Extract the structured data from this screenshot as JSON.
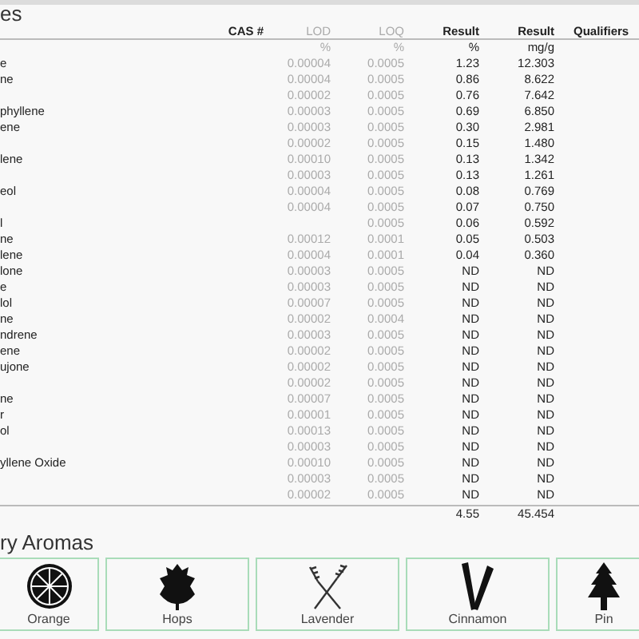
{
  "section_title": "es",
  "table": {
    "columns": [
      "CAS #",
      "LOD",
      "LOQ",
      "Result",
      "Result",
      "Qualifiers"
    ],
    "units": [
      "%",
      "%",
      "%",
      "mg/g"
    ],
    "rows": [
      {
        "name": "e",
        "lod": "0.00004",
        "loq": "0.0005",
        "result_pct": "1.23",
        "result_mg": "12.303"
      },
      {
        "name": "ne",
        "lod": "0.00004",
        "loq": "0.0005",
        "result_pct": "0.86",
        "result_mg": "8.622"
      },
      {
        "lod": "0.00002",
        "loq": "0.0005",
        "result_pct": "0.76",
        "result_mg": "7.642"
      },
      {
        "name": "phyllene",
        "lod": "0.00003",
        "loq": "0.0005",
        "result_pct": "0.69",
        "result_mg": "6.850"
      },
      {
        "name": "ene",
        "lod": "0.00003",
        "loq": "0.0005",
        "result_pct": "0.30",
        "result_mg": "2.981"
      },
      {
        "lod": "0.00002",
        "loq": "0.0005",
        "result_pct": "0.15",
        "result_mg": "1.480"
      },
      {
        "name": "lene",
        "lod": "0.00010",
        "loq": "0.0005",
        "result_pct": "0.13",
        "result_mg": "1.342"
      },
      {
        "lod": "0.00003",
        "loq": "0.0005",
        "result_pct": "0.13",
        "result_mg": "1.261"
      },
      {
        "name": "eol",
        "lod": "0.00004",
        "loq": "0.0005",
        "result_pct": "0.08",
        "result_mg": "0.769"
      },
      {
        "lod": "0.00004",
        "loq": "0.0005",
        "result_pct": "0.07",
        "result_mg": "0.750"
      },
      {
        "name": "l",
        "loq": "0.0005",
        "result_pct": "0.06",
        "result_mg": "0.592"
      },
      {
        "name": "ne",
        "lod": "0.00012",
        "loq": "0.0001",
        "result_pct": "0.05",
        "result_mg": "0.503"
      },
      {
        "name": "lene",
        "lod": "0.00004",
        "loq": "0.0001",
        "result_pct": "0.04",
        "result_mg": "0.360"
      },
      {
        "name": "lone",
        "lod": "0.00003",
        "loq": "0.0005",
        "result_pct": "ND",
        "result_mg": "ND"
      },
      {
        "name": "e",
        "lod": "0.00003",
        "loq": "0.0005",
        "result_pct": "ND",
        "result_mg": "ND"
      },
      {
        "name": "lol",
        "lod": "0.00007",
        "loq": "0.0005",
        "result_pct": "ND",
        "result_mg": "ND"
      },
      {
        "name": "ne",
        "lod": "0.00002",
        "loq": "0.0004",
        "result_pct": "ND",
        "result_mg": "ND"
      },
      {
        "name": "ndrene",
        "lod": "0.00003",
        "loq": "0.0005",
        "result_pct": "ND",
        "result_mg": "ND"
      },
      {
        "name": "ene",
        "lod": "0.00002",
        "loq": "0.0005",
        "result_pct": "ND",
        "result_mg": "ND"
      },
      {
        "name": "ujone",
        "lod": "0.00002",
        "loq": "0.0005",
        "result_pct": "ND",
        "result_mg": "ND"
      },
      {
        "lod": "0.00002",
        "loq": "0.0005",
        "result_pct": "ND",
        "result_mg": "ND"
      },
      {
        "name": "ne",
        "lod": "0.00007",
        "loq": "0.0005",
        "result_pct": "ND",
        "result_mg": "ND"
      },
      {
        "name": "r",
        "lod": "0.00001",
        "loq": "0.0005",
        "result_pct": "ND",
        "result_mg": "ND"
      },
      {
        "name": "ol",
        "lod": "0.00013",
        "loq": "0.0005",
        "result_pct": "ND",
        "result_mg": "ND"
      },
      {
        "lod": "0.00003",
        "loq": "0.0005",
        "result_pct": "ND",
        "result_mg": "ND"
      },
      {
        "name": "yllene Oxide",
        "lod": "0.00010",
        "loq": "0.0005",
        "result_pct": "ND",
        "result_mg": "ND"
      },
      {
        "lod": "0.00003",
        "loq": "0.0005",
        "result_pct": "ND",
        "result_mg": "ND"
      },
      {
        "lod": "0.00002",
        "loq": "0.0005",
        "result_pct": "ND",
        "result_mg": "ND"
      }
    ],
    "totals": [
      "4.55",
      "45.454"
    ]
  },
  "aromas": {
    "title": "ry Aromas",
    "items": [
      {
        "kind": "orange",
        "label": "Orange"
      },
      {
        "kind": "hops",
        "label": "Hops"
      },
      {
        "kind": "lavender",
        "label": "Lavender"
      },
      {
        "kind": "cinnamon",
        "label": "Cinnamon"
      },
      {
        "kind": "pine",
        "label": "Pin"
      }
    ]
  }
}
